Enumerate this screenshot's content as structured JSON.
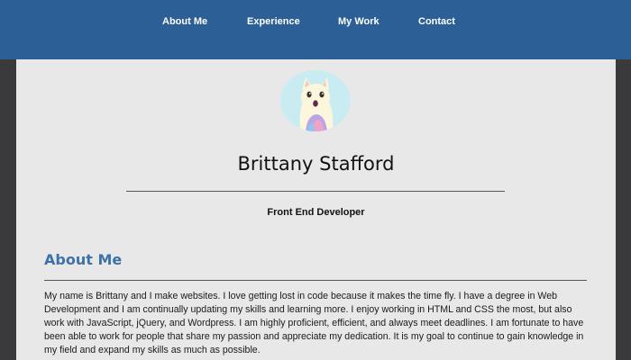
{
  "nav": {
    "items": [
      {
        "label": "About Me"
      },
      {
        "label": "Experience"
      },
      {
        "label": "My Work"
      },
      {
        "label": "Contact"
      }
    ]
  },
  "profile": {
    "avatar_icon": "cat-avatar-icon",
    "name": "Brittany Stafford",
    "role": "Front End Developer"
  },
  "about": {
    "heading": "About Me",
    "body": "My name is Brittany and I make websites. I love getting lost in code because it makes the time fly. I have a degree in Web Development and I am continually updating my skills and learning more. I enjoy working in HTML and CSS the most, but also work with JavaScript, jQuery, and Wordpress. I am highly proficient, efficient, and always meet deadlines. I am fortunate to have been able to work for people that share my passion and appreciate my dedication. It is my goal to continue to gain knowledge in my field and expand my skills as much as possible."
  },
  "colors": {
    "navbar": "#2b5f95",
    "heading": "#3d72a8",
    "page_bg": "#e8e8e8",
    "outer_bg": "#3a3a3d"
  }
}
